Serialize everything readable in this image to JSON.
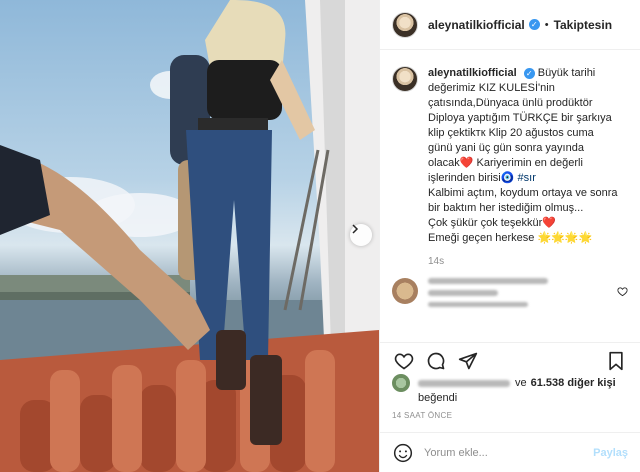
{
  "post": {
    "username": "aleynatilkiofficial",
    "follow_status": "Takiptesin",
    "caption": {
      "username": "aleynatilkiofficial",
      "text_lines": [
        "Büyük tarihi",
        "değerimiz KIZ KULESİ'nin",
        "çatısında,Dünyaca ünlü prodüktör",
        "Diploya yaptığım TÜRKÇE bir şarkıya",
        "klip çektikтк Klip 20 ağustos cuma",
        "günü yani üç gün sonra yayında",
        "olacak❤️ Kariyerimin en değerli",
        "işlerinden birisi🧿 ",
        "Kalbimi açtım, koydum ortaya ve sonra",
        "bir baktım her istediğim olmuş...",
        "Çok şükür çok teşekkür❤️",
        "Emeği geçen herkese 🌟🌟🌟🌟"
      ],
      "hashtag": "#sır",
      "time": "14s"
    },
    "likes": {
      "text_prefix": "ve",
      "count_text": "61.538 diğer kişi",
      "suffix": "beğendi"
    },
    "posted_ago": "14 SAAT ÖNCE",
    "comment_placeholder": "Yorum ekle...",
    "post_button": "Paylaş",
    "colors": {
      "verified": "#3897f0",
      "link": "#00376b",
      "post_disabled": "#b2dffc",
      "secondary_text": "#8e8e8e"
    },
    "icons": [
      "heart-icon",
      "comment-icon",
      "share-icon",
      "bookmark-icon",
      "emoji-icon",
      "chevron-right-icon",
      "verified-icon"
    ]
  }
}
